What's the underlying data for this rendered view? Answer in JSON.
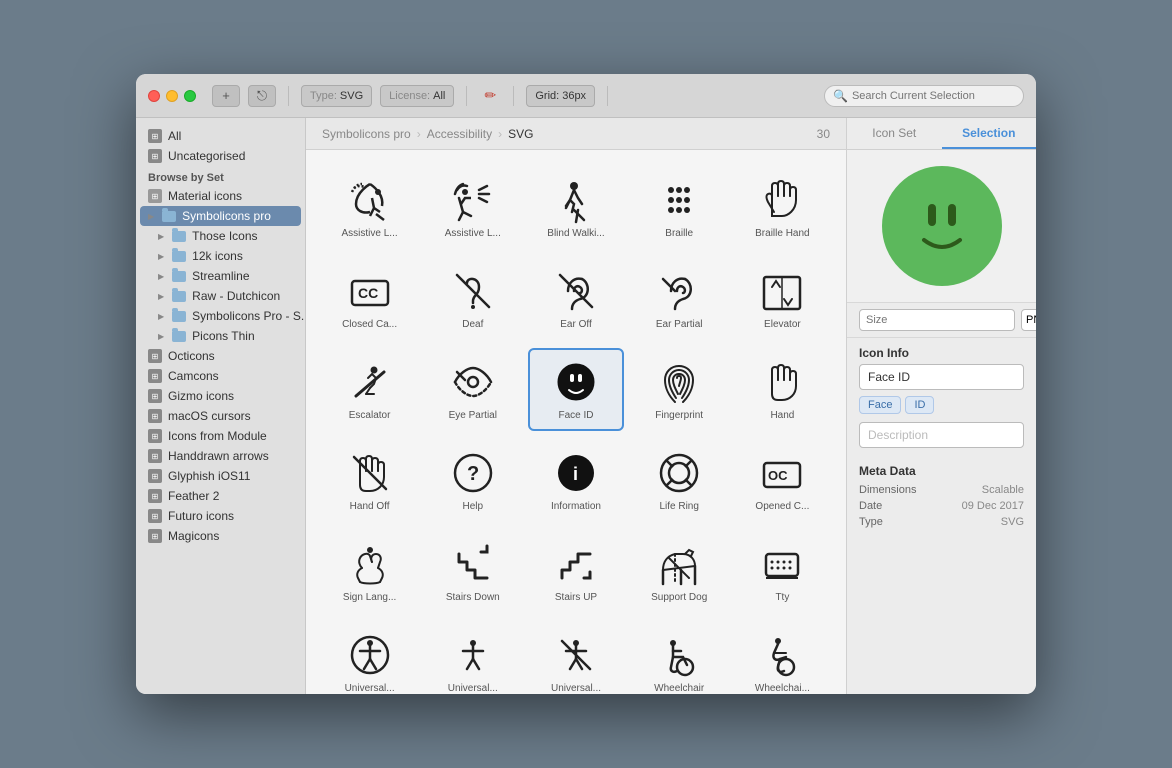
{
  "window": {
    "title": "Symbolicons pro — Accessibility — SVG"
  },
  "titlebar": {
    "type_label": "Type:",
    "type_val": "SVG",
    "license_label": "License:",
    "license_val": "All",
    "grid_label": "Grid:",
    "grid_val": "36px",
    "search_placeholder": "Search Current Selection"
  },
  "sidebar": {
    "items_top": [
      {
        "id": "all",
        "label": "All",
        "icon": "grid"
      },
      {
        "id": "uncategorised",
        "label": "Uncategorised",
        "icon": "grid"
      }
    ],
    "section_label": "Browse by Set",
    "sets": [
      {
        "id": "material",
        "label": "Material icons",
        "icon": "folder",
        "active": false,
        "has_arrow": false
      },
      {
        "id": "symbolicons-pro",
        "label": "Symbolicons pro",
        "icon": "folder",
        "active": true,
        "has_arrow": true
      },
      {
        "id": "those-icons",
        "label": "Those Icons",
        "icon": "folder",
        "active": false,
        "has_arrow": true
      },
      {
        "id": "12k-icons",
        "label": "12k icons",
        "icon": "folder",
        "active": false,
        "has_arrow": true
      },
      {
        "id": "streamline",
        "label": "Streamline",
        "icon": "folder",
        "active": false,
        "has_arrow": true
      },
      {
        "id": "raw-dutchicon",
        "label": "Raw - Dutchicon",
        "icon": "folder",
        "active": false,
        "has_arrow": true
      },
      {
        "id": "symbolicons-pro-s",
        "label": "Symbolicons Pro - S...",
        "icon": "folder",
        "active": false,
        "has_arrow": true
      },
      {
        "id": "picons-thin",
        "label": "Picons Thin",
        "icon": "folder",
        "active": false,
        "has_arrow": true
      },
      {
        "id": "octicons",
        "label": "Octicons",
        "icon": "grid",
        "active": false
      },
      {
        "id": "camcons",
        "label": "Camcons",
        "icon": "grid",
        "active": false
      },
      {
        "id": "gizmo-icons",
        "label": "Gizmo icons",
        "icon": "grid",
        "active": false
      },
      {
        "id": "macos-cursors",
        "label": "macOS cursors",
        "icon": "grid",
        "active": false
      },
      {
        "id": "icons-from-module",
        "label": "Icons from Module",
        "icon": "grid",
        "active": false
      },
      {
        "id": "handdrawn-arrows",
        "label": "Handdrawn arrows",
        "icon": "grid",
        "active": false
      },
      {
        "id": "glyphish-ios11",
        "label": "Glyphish iOS11",
        "icon": "grid",
        "active": false
      },
      {
        "id": "feather-2",
        "label": "Feather 2",
        "icon": "grid",
        "active": false
      },
      {
        "id": "futuro-icons",
        "label": "Futuro icons",
        "icon": "grid",
        "active": false
      },
      {
        "id": "magicons",
        "label": "Magicons",
        "icon": "grid",
        "active": false
      }
    ]
  },
  "breadcrumb": {
    "parts": [
      "Symbolicons pro",
      "Accessibility",
      "SVG"
    ],
    "count": "30"
  },
  "icons": [
    {
      "id": "assistive-1",
      "label": "Assistive L...",
      "selected": false
    },
    {
      "id": "assistive-2",
      "label": "Assistive L...",
      "selected": false
    },
    {
      "id": "blind-walking",
      "label": "Blind Walki...",
      "selected": false
    },
    {
      "id": "braille",
      "label": "Braille",
      "selected": false
    },
    {
      "id": "braille-hand",
      "label": "Braille Hand",
      "selected": false
    },
    {
      "id": "closed-ca",
      "label": "Closed Ca...",
      "selected": false
    },
    {
      "id": "deaf",
      "label": "Deaf",
      "selected": false
    },
    {
      "id": "ear-off",
      "label": "Ear Off",
      "selected": false
    },
    {
      "id": "ear-partial",
      "label": "Ear Partial",
      "selected": false
    },
    {
      "id": "elevator",
      "label": "Elevator",
      "selected": false
    },
    {
      "id": "escalator",
      "label": "Escalator",
      "selected": false
    },
    {
      "id": "eye-partial",
      "label": "Eye Partial",
      "selected": false
    },
    {
      "id": "face-id",
      "label": "Face ID",
      "selected": true
    },
    {
      "id": "fingerprint",
      "label": "Fingerprint",
      "selected": false
    },
    {
      "id": "hand",
      "label": "Hand",
      "selected": false
    },
    {
      "id": "hand-off",
      "label": "Hand Off",
      "selected": false
    },
    {
      "id": "help",
      "label": "Help",
      "selected": false
    },
    {
      "id": "information",
      "label": "Information",
      "selected": false
    },
    {
      "id": "life-ring",
      "label": "Life Ring",
      "selected": false
    },
    {
      "id": "opened-c",
      "label": "Opened C...",
      "selected": false
    },
    {
      "id": "sign-lang",
      "label": "Sign Lang...",
      "selected": false
    },
    {
      "id": "stairs-down",
      "label": "Stairs Down",
      "selected": false
    },
    {
      "id": "stairs-up",
      "label": "Stairs UP",
      "selected": false
    },
    {
      "id": "support-dog",
      "label": "Support Dog",
      "selected": false
    },
    {
      "id": "tty",
      "label": "Tty",
      "selected": false
    },
    {
      "id": "universal-1",
      "label": "Universal...",
      "selected": false
    },
    {
      "id": "universal-2",
      "label": "Universal...",
      "selected": false
    },
    {
      "id": "universal-3",
      "label": "Universal...",
      "selected": false
    },
    {
      "id": "wheelchair",
      "label": "Wheelchair",
      "selected": false
    },
    {
      "id": "wheelchair-2",
      "label": "Wheelchai...",
      "selected": false
    }
  ],
  "right_panel": {
    "tabs": [
      {
        "id": "icon-set",
        "label": "Icon Set",
        "active": false
      },
      {
        "id": "selection",
        "label": "Selection",
        "active": true
      }
    ],
    "preview_color": "#5cb85c",
    "size_placeholder": "Size",
    "format": "PNG",
    "section_icon_info": "Icon Info",
    "icon_name": "Face ID",
    "tags": [
      "Face",
      "ID"
    ],
    "description_placeholder": "Description",
    "section_meta": "Meta Data",
    "meta": [
      {
        "key": "Dimensions",
        "val": "Scalable"
      },
      {
        "key": "Date",
        "val": "09 Dec 2017"
      },
      {
        "key": "Type",
        "val": "SVG"
      }
    ]
  }
}
